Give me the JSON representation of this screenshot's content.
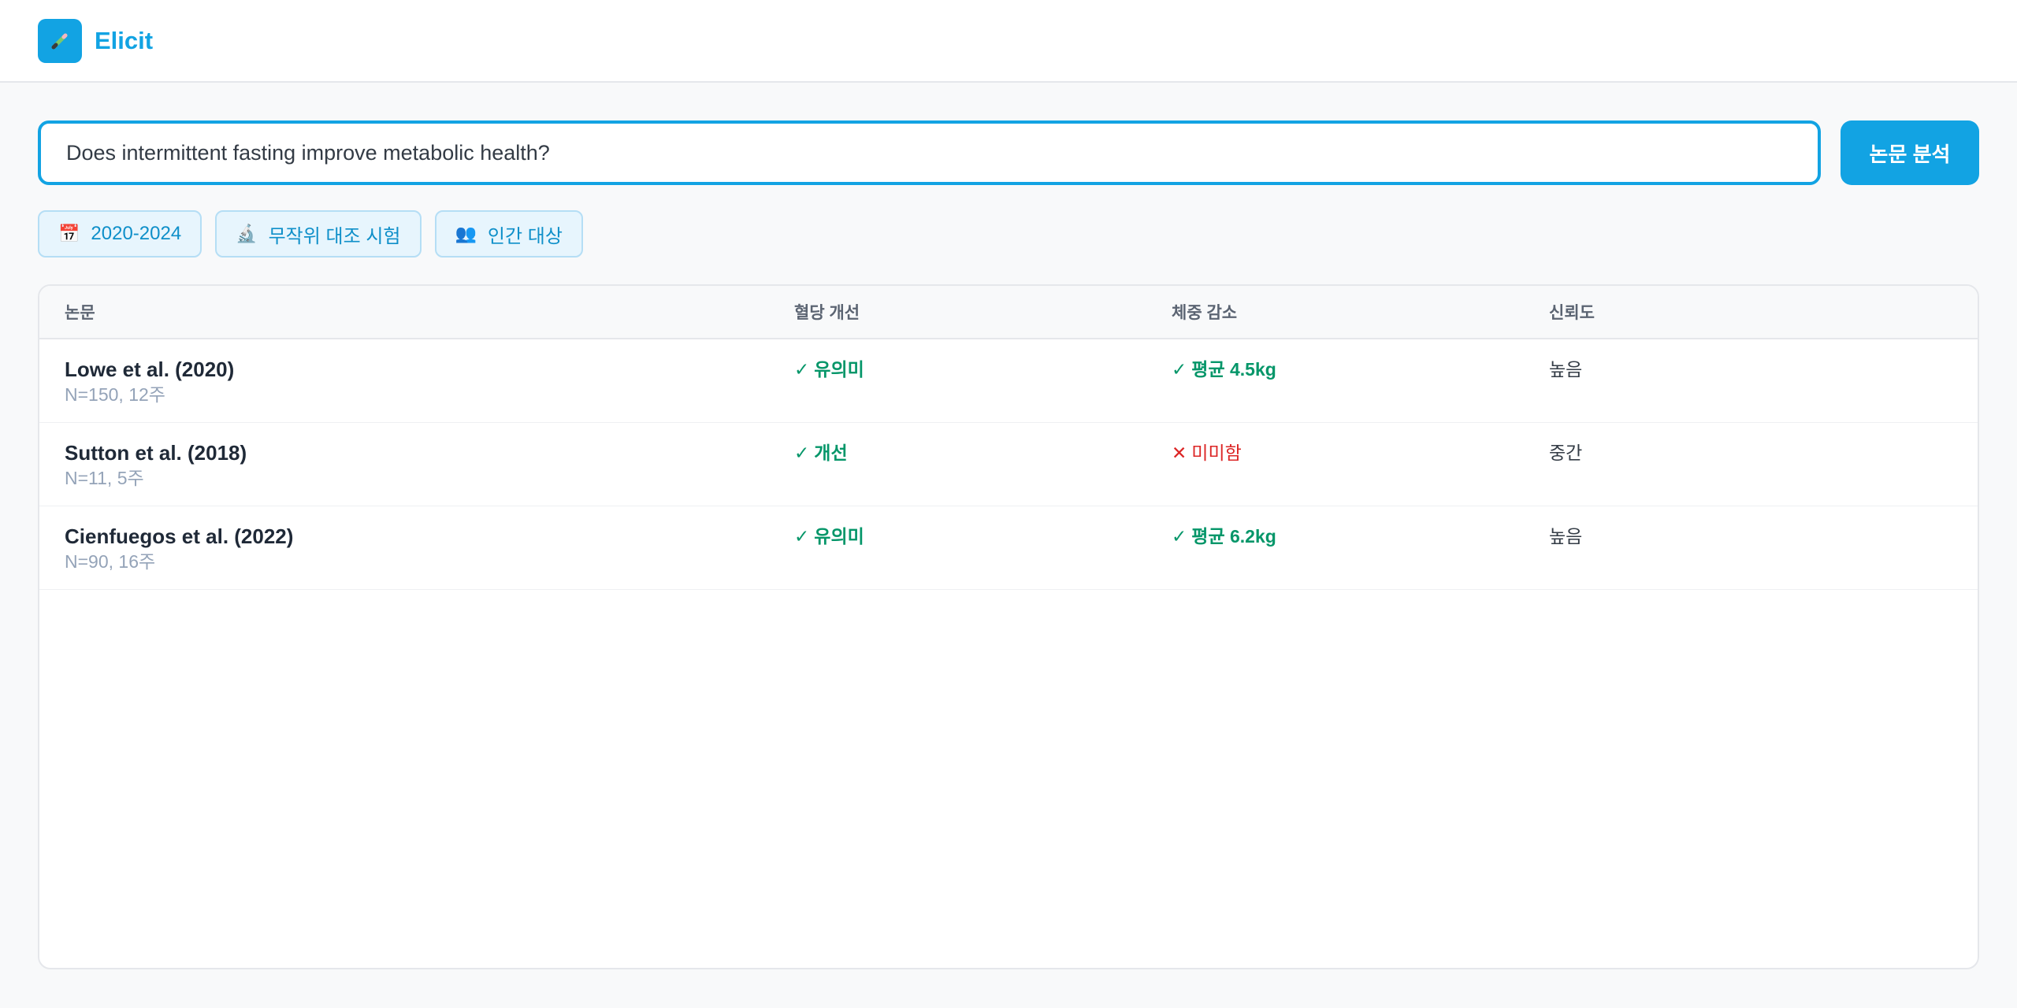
{
  "app": {
    "name": "Elicit",
    "logo_icon": "pencil-icon",
    "accent_color": "#12a3e3"
  },
  "search": {
    "value": "Does intermittent fasting improve metabolic health?",
    "button_label": "논문 분석"
  },
  "filters": [
    {
      "icon": "calendar-icon",
      "glyph": "📅",
      "label": "2020-2024"
    },
    {
      "icon": "microscope-icon",
      "glyph": "🔬",
      "label": "무작위 대조 시험"
    },
    {
      "icon": "people-icon",
      "glyph": "👥",
      "label": "인간 대상"
    }
  ],
  "table": {
    "headers": [
      "논문",
      "혈당 개선",
      "체중 감소",
      "신뢰도"
    ],
    "rows": [
      {
        "title": "Lowe et al. (2020)",
        "meta": "N=150, 12주",
        "glucose": {
          "mark": "✓",
          "text": "유의미",
          "status": "positive"
        },
        "weight": {
          "mark": "✓",
          "text": "평균 4.5kg",
          "status": "positive"
        },
        "confidence": "높음"
      },
      {
        "title": "Sutton et al. (2018)",
        "meta": "N=11, 5주",
        "glucose": {
          "mark": "✓",
          "text": "개선",
          "status": "positive"
        },
        "weight": {
          "mark": "✕",
          "text": "미미함",
          "status": "negative"
        },
        "confidence": "중간"
      },
      {
        "title": "Cienfuegos et al. (2022)",
        "meta": "N=90, 16주",
        "glucose": {
          "mark": "✓",
          "text": "유의미",
          "status": "positive"
        },
        "weight": {
          "mark": "✓",
          "text": "평균 6.2kg",
          "status": "positive"
        },
        "confidence": "높음"
      }
    ]
  },
  "colors": {
    "positive": "#059669",
    "negative": "#dc2626"
  }
}
